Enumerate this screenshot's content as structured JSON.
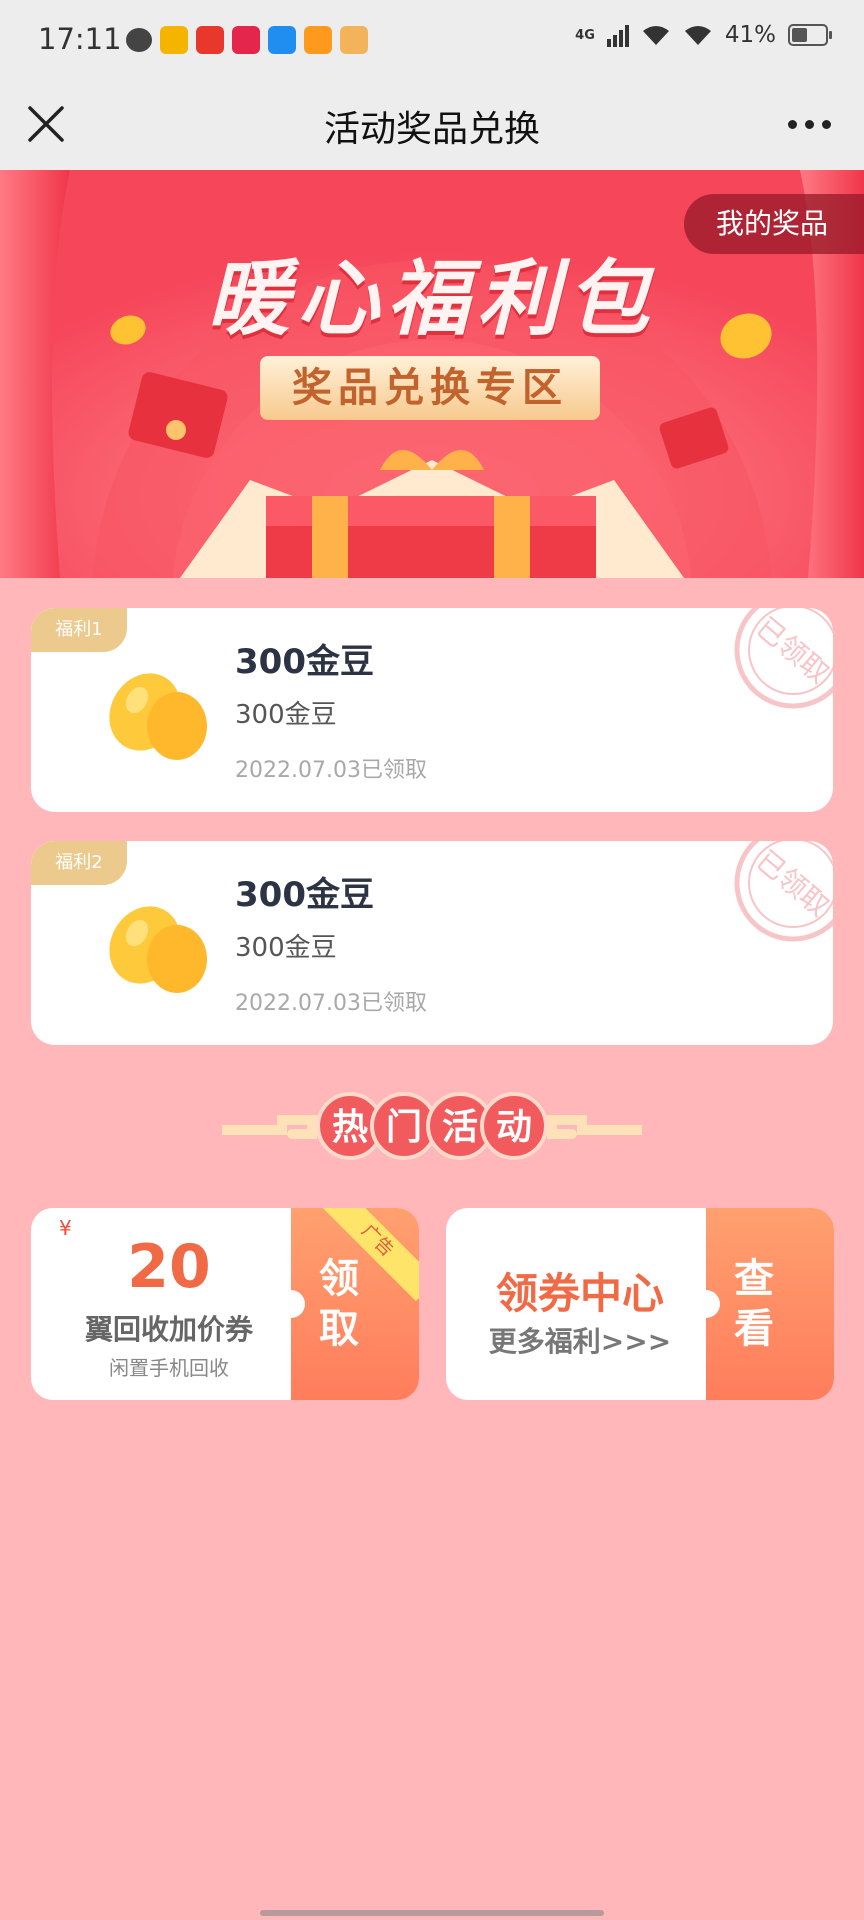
{
  "status_bar": {
    "time": "17:11",
    "network": "4G",
    "battery": "41%",
    "battery_level": 0.41,
    "notification_icons": [
      {
        "icon": "chat-bubble-icon"
      },
      {
        "icon": "app-icon-yellow",
        "color": "#f5b400"
      },
      {
        "icon": "app-icon-red",
        "color": "#e8382c"
      },
      {
        "icon": "app-icon-red-pink",
        "color": "#e4254c"
      },
      {
        "icon": "app-icon-blue",
        "color": "#1f8ef0"
      },
      {
        "icon": "app-icon-orange",
        "color": "#ff9a1f"
      },
      {
        "icon": "app-icon-tan",
        "color": "#f2b35a"
      }
    ]
  },
  "nav": {
    "title": "活动奖品兑换",
    "close_icon": "close-icon",
    "more_icon": "more-icon"
  },
  "banner": {
    "headline": "暖心福利包",
    "subtitle": "奖品兑换专区",
    "my_prizes": "我的奖品"
  },
  "rewards": [
    {
      "badge": "福利1",
      "title": "300金豆",
      "desc": "300金豆",
      "date": "2022.07.03已领取",
      "stamp": "已领取"
    },
    {
      "badge": "福利2",
      "title": "300金豆",
      "desc": "300金豆",
      "date": "2022.07.03已领取",
      "stamp": "已领取"
    }
  ],
  "hot_section": {
    "chars": [
      "热",
      "门",
      "活",
      "动"
    ]
  },
  "promos": {
    "coupon": {
      "yen": "¥",
      "amount": "20",
      "name": "翼回收加价券",
      "sub": "闲置手机回收",
      "button_chars": [
        "领",
        "取"
      ],
      "ad_label": "广告"
    },
    "center": {
      "title": "领券中心",
      "sub": "更多福利>>>",
      "button_chars": [
        "查",
        "看"
      ]
    }
  },
  "colors": {
    "page_bg": "#ffb7b9",
    "banner_red": "#f6465a",
    "accent_orange": "#f06a46",
    "badge_gold": "#ecc98c"
  }
}
